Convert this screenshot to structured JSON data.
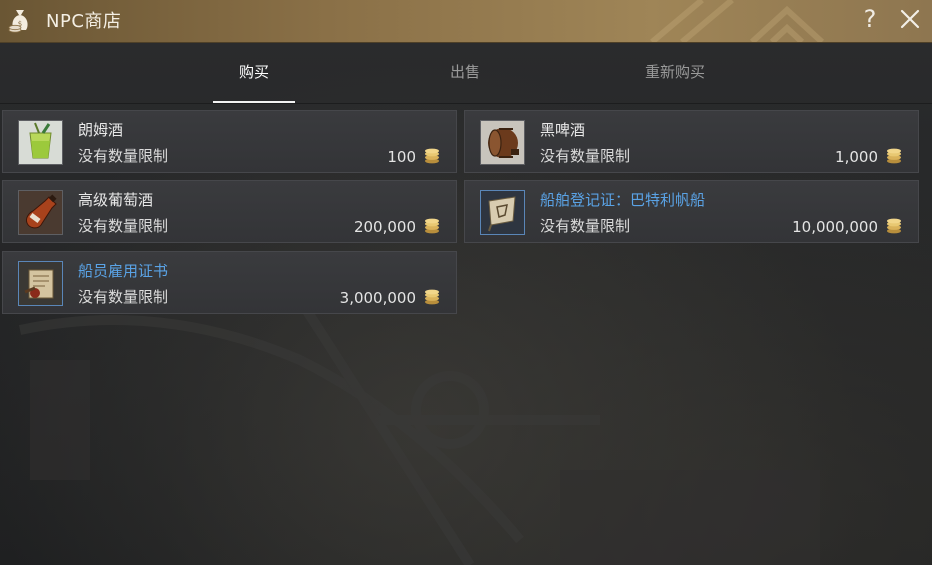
{
  "window": {
    "title": "NPC商店",
    "help_label": "?",
    "icons": {
      "title": "money-bag-icon",
      "close": "close-icon"
    }
  },
  "tabs": [
    {
      "label": "购买",
      "active": true
    },
    {
      "label": "出售",
      "active": false
    },
    {
      "label": "重新购买",
      "active": false
    }
  ],
  "items": [
    {
      "name": "朗姆酒",
      "limit": "没有数量限制",
      "price": "100",
      "icon": "rum-cup-icon",
      "special": false
    },
    {
      "name": "黑啤酒",
      "limit": "没有数量限制",
      "price": "1,000",
      "icon": "beer-barrel-icon",
      "special": false
    },
    {
      "name": "高级葡萄酒",
      "limit": "没有数量限制",
      "price": "200,000",
      "icon": "wine-bottle-icon",
      "special": false
    },
    {
      "name": "船舶登记证：巴特利帆船",
      "limit": "没有数量限制",
      "price": "10,000,000",
      "icon": "ship-flag-icon",
      "special": true
    },
    {
      "name": "船员雇用证书",
      "limit": "没有数量限制",
      "price": "3,000,000",
      "icon": "scroll-certificate-icon",
      "special": true
    }
  ],
  "colors": {
    "titlebar": "#8a7047",
    "special_name": "#5aa3e6",
    "coin": "#d9b25a"
  }
}
